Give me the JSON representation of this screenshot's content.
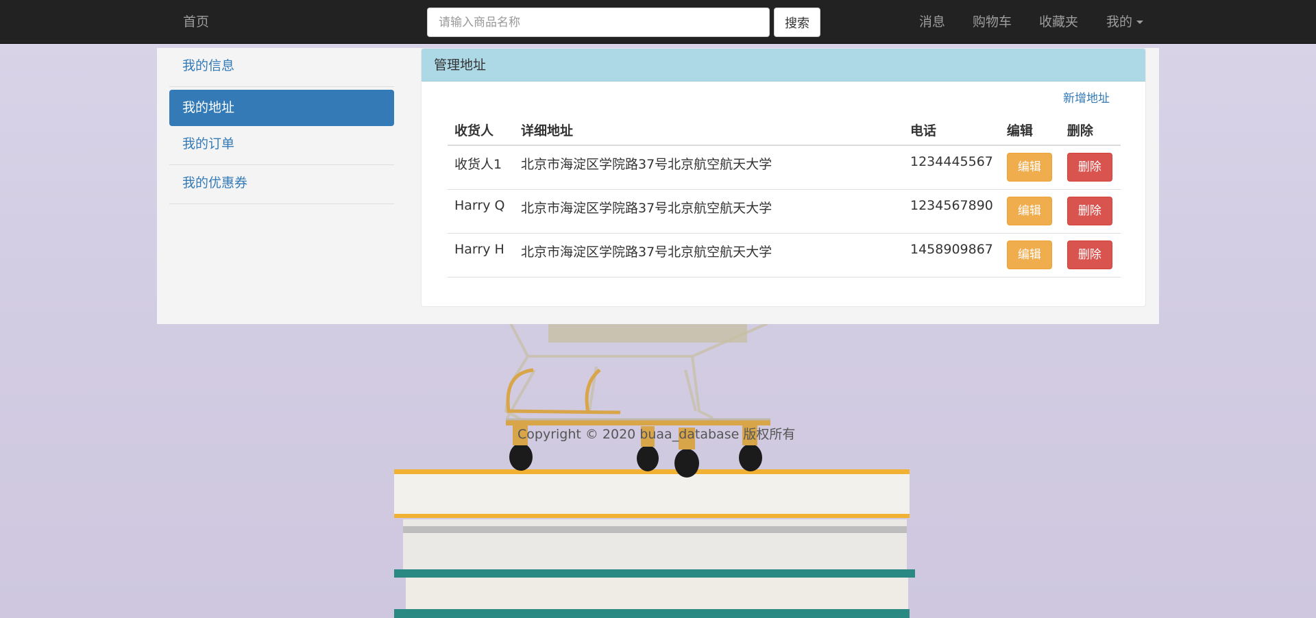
{
  "navbar": {
    "home": "首页",
    "search_placeholder": "请输入商品名称",
    "search_button": "搜索",
    "messages": "消息",
    "cart": "购物车",
    "favorites": "收藏夹",
    "mine": "我的"
  },
  "sidebar": {
    "items": [
      {
        "label": "我的信息"
      },
      {
        "label": "我的地址"
      },
      {
        "label": "我的订单"
      },
      {
        "label": "我的优惠券"
      }
    ],
    "active_index": 1
  },
  "panel": {
    "title": "管理地址",
    "add_link": "新增地址",
    "columns": [
      "收货人",
      "详细地址",
      "电话",
      "编辑",
      "删除"
    ],
    "rows": [
      {
        "name": "收货人1",
        "address": "北京市海淀区学院路37号北京航空航天大学",
        "phone": "1234445567",
        "edit": "编辑",
        "delete": "删除"
      },
      {
        "name": "Harry Q",
        "address": "北京市海淀区学院路37号北京航空航天大学",
        "phone": "1234567890",
        "edit": "编辑",
        "delete": "删除"
      },
      {
        "name": "Harry H",
        "address": "北京市海淀区学院路37号北京航空航天大学",
        "phone": "1458909867",
        "edit": "编辑",
        "delete": "删除"
      }
    ]
  },
  "footer": "Copyright © 2020  buaa_database 版权所有",
  "colors": {
    "navbar_bg": "#222222",
    "primary": "#337ab7",
    "panel_heading": "#add8e6",
    "warning": "#f0ad4e",
    "danger": "#d9534f"
  }
}
